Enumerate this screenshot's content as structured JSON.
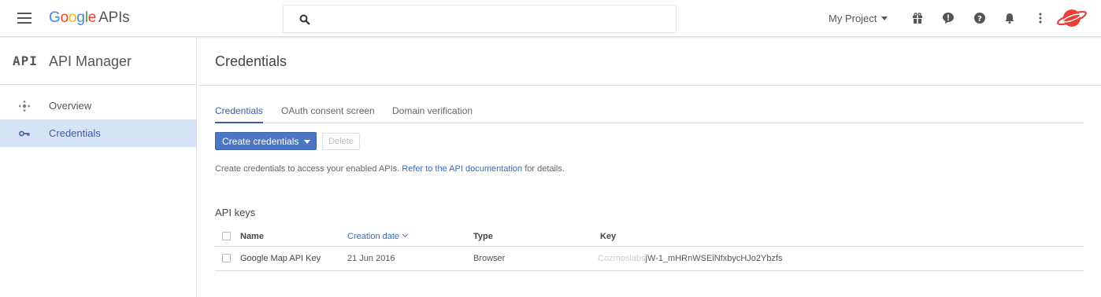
{
  "header": {
    "logo": {
      "g": "G",
      "o1": "o",
      "o2": "o",
      "g2": "g",
      "l": "l",
      "e": "e",
      "apis": "APIs"
    },
    "search": {
      "placeholder": "",
      "value": ""
    },
    "project_label": "My Project",
    "icons": [
      "gift-icon",
      "feedback-icon",
      "help-icon",
      "notifications-icon",
      "more-vert-icon"
    ],
    "avatar": "saturn-avatar-icon",
    "colors": {
      "brand_blue": "#4285f4",
      "avatar_red": "#e8413a"
    }
  },
  "sidebar": {
    "api_badge": "API",
    "title": "API Manager",
    "items": [
      {
        "label": "Overview",
        "icon": "overview-icon",
        "active": false
      },
      {
        "label": "Credentials",
        "icon": "key-icon",
        "active": true
      }
    ]
  },
  "main": {
    "title": "Credentials",
    "tabs": [
      {
        "label": "Credentials",
        "active": true
      },
      {
        "label": "OAuth consent screen",
        "active": false
      },
      {
        "label": "Domain verification",
        "active": false
      }
    ],
    "create_button": "Create credentials",
    "delete_button": "Delete",
    "info_text": "Create credentials to access your enabled APIs.",
    "info_link": "Refer to the API documentation",
    "info_suffix": "for details.",
    "section_title": "API keys",
    "table": {
      "columns": [
        "Name",
        "Creation date",
        "Type",
        "Key"
      ],
      "sorted_column": "Creation date",
      "rows": [
        {
          "name": "Google Map API Key",
          "date": "21 Jun 2016",
          "type": "Browser",
          "key_prefix": "Cozmoslabs",
          "key": "jW-1_mHRnWSEiNfxbycHJo2Ybzfs"
        }
      ]
    },
    "colors": {
      "accent": "#3b5ea0",
      "primary_button": "#4a76c3",
      "active_nav_bg": "#d6e3f7"
    }
  }
}
